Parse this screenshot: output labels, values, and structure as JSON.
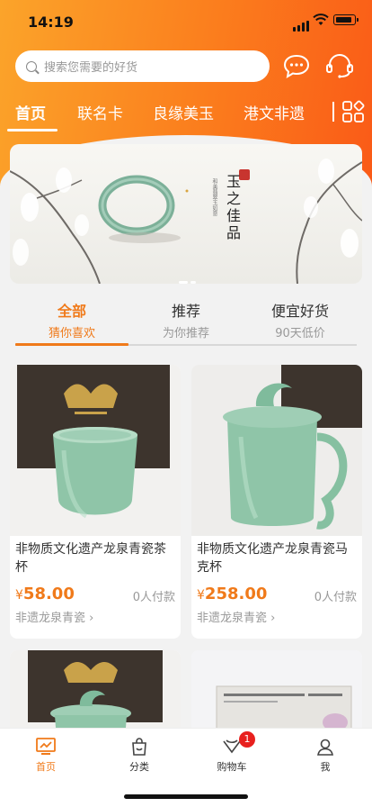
{
  "status": {
    "time": "14:19"
  },
  "search": {
    "placeholder": "搜索您需要的好货"
  },
  "colors": {
    "accent": "#f07a1a",
    "header_start": "#fba42a",
    "header_end": "#fa5a17",
    "badge": "#e8201e"
  },
  "top_tabs": [
    "首页",
    "联名卡",
    "良缘美玉",
    "港文非遗"
  ],
  "banner": {
    "title": "玉之佳品",
    "subtitle": "和美翡翠玉如意"
  },
  "category_tabs": [
    {
      "main": "全部",
      "sub": "猜你喜欢"
    },
    {
      "main": "推荐",
      "sub": "为你推荐"
    },
    {
      "main": "便宜好货",
      "sub": "90天低价"
    }
  ],
  "products": [
    {
      "title": "非物质文化遗产龙泉青瓷茶杯",
      "currency": "¥",
      "price": "58.00",
      "paid": "0人付款",
      "shop": "非遗龙泉青瓷"
    },
    {
      "title": "非物质文化遗产龙泉青瓷马克杯",
      "currency": "¥",
      "price": "258.00",
      "paid": "0人付款",
      "shop": "非遗龙泉青瓷"
    }
  ],
  "tabbar": {
    "home": "首页",
    "category": "分类",
    "cart": "购物车",
    "me": "我",
    "cart_badge": "1"
  }
}
